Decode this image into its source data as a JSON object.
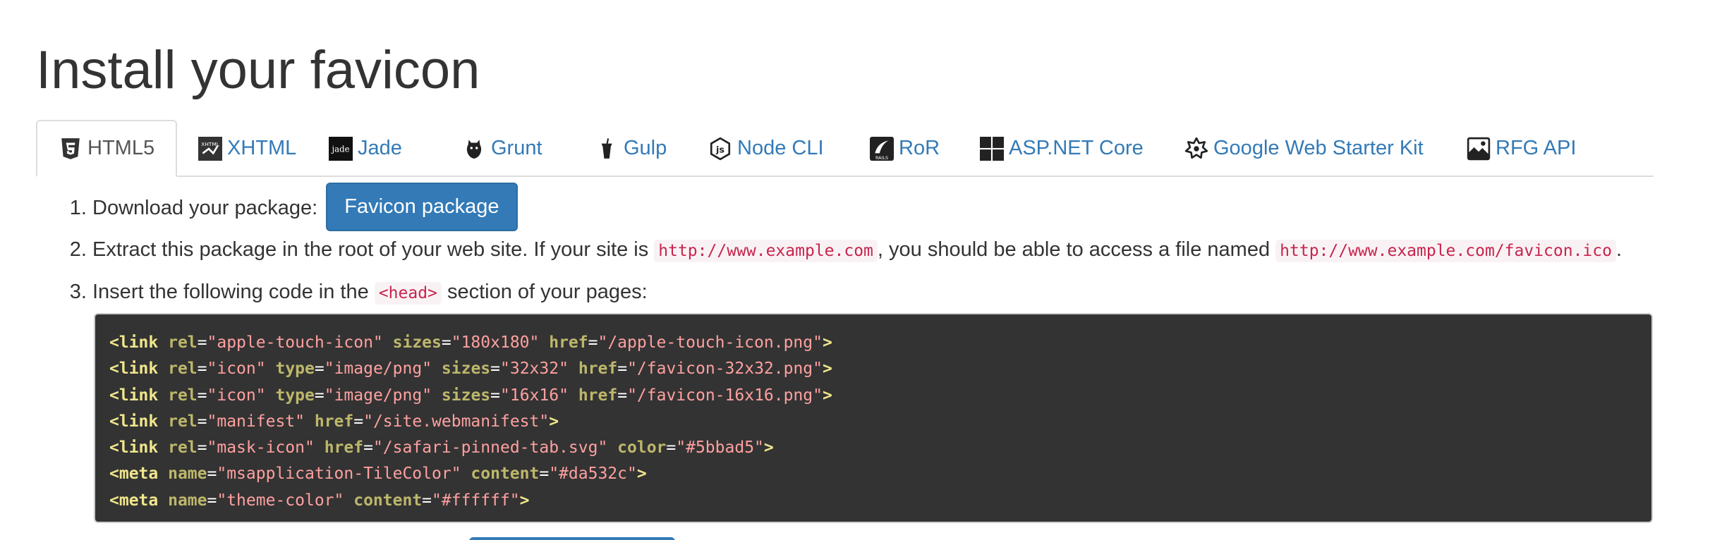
{
  "page_title": "Install your favicon",
  "tabs": [
    {
      "label": "HTML5",
      "icon": "html5-icon",
      "active": true
    },
    {
      "label": "XHTML",
      "icon": "xhtml-icon",
      "active": false
    },
    {
      "label": "Jade",
      "icon": "jade-icon",
      "active": false
    },
    {
      "label": "Grunt",
      "icon": "grunt-icon",
      "active": false
    },
    {
      "label": "Gulp",
      "icon": "gulp-icon",
      "active": false
    },
    {
      "label": "Node CLI",
      "icon": "nodejs-icon",
      "active": false
    },
    {
      "label": "RoR",
      "icon": "rails-icon",
      "active": false
    },
    {
      "label": "ASP.NET Core",
      "icon": "windows-icon",
      "active": false
    },
    {
      "label": "Google Web Starter Kit",
      "icon": "starter-kit-icon",
      "active": false
    },
    {
      "label": "RFG API",
      "icon": "rfg-api-icon",
      "active": false
    }
  ],
  "icon_text": {
    "xhtml": "XHTML",
    "jade": "jade",
    "rails": "RAILS"
  },
  "steps": {
    "step1_text": "Download your package:",
    "download_button": "Favicon package",
    "step2_prefix": "Extract this package in the root of your web site. If your site is ",
    "step2_code1": "http://www.example.com",
    "step2_middle": ", you should be able to access a file named ",
    "step2_code2": "http://www.example.com/favicon.ico",
    "step2_suffix": ".",
    "step3_prefix": "Insert the following code in the ",
    "step3_code": "<head>",
    "step3_suffix": " section of your pages:"
  },
  "code_lines": [
    [
      [
        "t",
        "<link"
      ],
      [
        "s",
        " "
      ],
      [
        "a",
        "rel"
      ],
      [
        "e",
        "="
      ],
      [
        "v",
        "\"apple-touch-icon\""
      ],
      [
        "s",
        " "
      ],
      [
        "a",
        "sizes"
      ],
      [
        "e",
        "="
      ],
      [
        "v",
        "\"180x180\""
      ],
      [
        "s",
        " "
      ],
      [
        "a",
        "href"
      ],
      [
        "e",
        "="
      ],
      [
        "v",
        "\"/apple-touch-icon.png\""
      ],
      [
        "t",
        ">"
      ]
    ],
    [
      [
        "t",
        "<link"
      ],
      [
        "s",
        " "
      ],
      [
        "a",
        "rel"
      ],
      [
        "e",
        "="
      ],
      [
        "v",
        "\"icon\""
      ],
      [
        "s",
        " "
      ],
      [
        "a",
        "type"
      ],
      [
        "e",
        "="
      ],
      [
        "v",
        "\"image/png\""
      ],
      [
        "s",
        " "
      ],
      [
        "a",
        "sizes"
      ],
      [
        "e",
        "="
      ],
      [
        "v",
        "\"32x32\""
      ],
      [
        "s",
        " "
      ],
      [
        "a",
        "href"
      ],
      [
        "e",
        "="
      ],
      [
        "v",
        "\"/favicon-32x32.png\""
      ],
      [
        "t",
        ">"
      ]
    ],
    [
      [
        "t",
        "<link"
      ],
      [
        "s",
        " "
      ],
      [
        "a",
        "rel"
      ],
      [
        "e",
        "="
      ],
      [
        "v",
        "\"icon\""
      ],
      [
        "s",
        " "
      ],
      [
        "a",
        "type"
      ],
      [
        "e",
        "="
      ],
      [
        "v",
        "\"image/png\""
      ],
      [
        "s",
        " "
      ],
      [
        "a",
        "sizes"
      ],
      [
        "e",
        "="
      ],
      [
        "v",
        "\"16x16\""
      ],
      [
        "s",
        " "
      ],
      [
        "a",
        "href"
      ],
      [
        "e",
        "="
      ],
      [
        "v",
        "\"/favicon-16x16.png\""
      ],
      [
        "t",
        ">"
      ]
    ],
    [
      [
        "t",
        "<link"
      ],
      [
        "s",
        " "
      ],
      [
        "a",
        "rel"
      ],
      [
        "e",
        "="
      ],
      [
        "v",
        "\"manifest\""
      ],
      [
        "s",
        " "
      ],
      [
        "a",
        "href"
      ],
      [
        "e",
        "="
      ],
      [
        "v",
        "\"/site.webmanifest\""
      ],
      [
        "t",
        ">"
      ]
    ],
    [
      [
        "t",
        "<link"
      ],
      [
        "s",
        " "
      ],
      [
        "a",
        "rel"
      ],
      [
        "e",
        "="
      ],
      [
        "v",
        "\"mask-icon\""
      ],
      [
        "s",
        " "
      ],
      [
        "a",
        "href"
      ],
      [
        "e",
        "="
      ],
      [
        "v",
        "\"/safari-pinned-tab.svg\""
      ],
      [
        "s",
        " "
      ],
      [
        "a",
        "color"
      ],
      [
        "e",
        "="
      ],
      [
        "v",
        "\"#5bbad5\""
      ],
      [
        "t",
        ">"
      ]
    ],
    [
      [
        "t",
        "<meta"
      ],
      [
        "s",
        " "
      ],
      [
        "a",
        "name"
      ],
      [
        "e",
        "="
      ],
      [
        "v",
        "\"msapplication-TileColor\""
      ],
      [
        "s",
        " "
      ],
      [
        "a",
        "content"
      ],
      [
        "e",
        "="
      ],
      [
        "v",
        "\"#da532c\""
      ],
      [
        "t",
        ">"
      ]
    ],
    [
      [
        "t",
        "<meta"
      ],
      [
        "s",
        " "
      ],
      [
        "a",
        "name"
      ],
      [
        "e",
        "="
      ],
      [
        "v",
        "\"theme-color\""
      ],
      [
        "s",
        " "
      ],
      [
        "a",
        "content"
      ],
      [
        "e",
        "="
      ],
      [
        "v",
        "\"#ffffff\""
      ],
      [
        "t",
        ">"
      ]
    ]
  ],
  "colors": {
    "link": "#337ab7",
    "button_bg": "#337ab7",
    "code_bg": "#333333",
    "inline_code": "#c7254e"
  }
}
